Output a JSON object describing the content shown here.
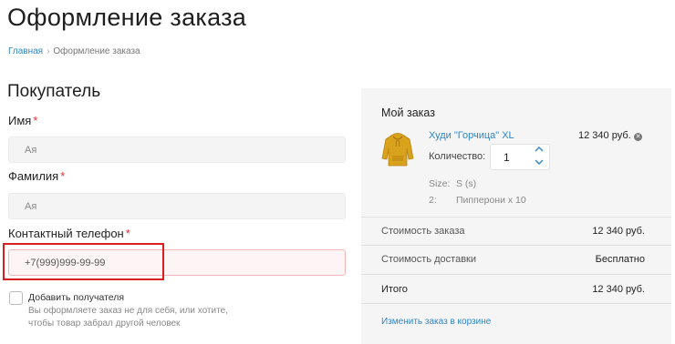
{
  "page": {
    "title": "Оформление заказа"
  },
  "breadcrumb": {
    "home": "Главная",
    "current": "Оформление заказа"
  },
  "buyer": {
    "section_title": "Покупатель",
    "first_name": {
      "label": "Имя",
      "required_mark": "*",
      "value": "Ая"
    },
    "last_name": {
      "label": "Фамилия",
      "required_mark": "*",
      "value": "Ая"
    },
    "phone": {
      "label": "Контактный телефон",
      "required_mark": "*",
      "value": "+7(999)999-99-99"
    },
    "add_recipient": {
      "label": "Добавить получателя",
      "checked": false,
      "hint": "Вы оформляете заказ не для себя, или хотите, чтобы товар забрал другой человек"
    }
  },
  "order": {
    "title": "Мой заказ",
    "item": {
      "name": "Худи \"Горчица\" XL",
      "price": "12 340 руб.",
      "quantity_label": "Количество:",
      "quantity": "1",
      "image": "yellow-hoodie",
      "image_color": "#d9a21c",
      "specs": [
        {
          "key": "Size:",
          "value": "S (s)"
        },
        {
          "key": "2:",
          "value": "Пипперони х 10"
        }
      ]
    },
    "summary": {
      "subtotal_label": "Стоимость заказа",
      "subtotal_value": "12 340 руб.",
      "delivery_label": "Стоимость доставки",
      "delivery_value": "Бесплатно",
      "total_label": "Итого",
      "total_value": "12 340 руб."
    },
    "edit_link": "Изменить заказ в корзине"
  },
  "colors": {
    "accent": "#2f86c6",
    "required": "#e03030",
    "highlight": "#d81e1e",
    "panel": "#f5f5f5"
  }
}
